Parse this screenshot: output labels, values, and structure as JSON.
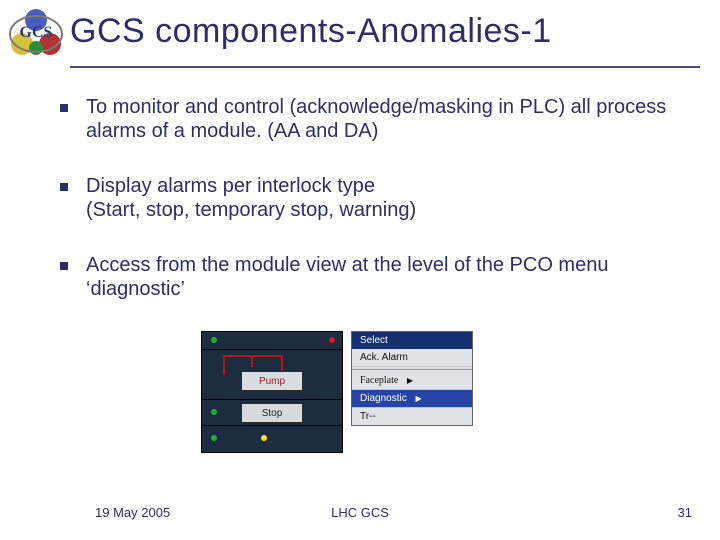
{
  "title": "GCS components-Anomalies-1",
  "logo_text": "GCS",
  "bullets": [
    "To monitor and control (acknowledge/masking in PLC) all process alarms of a module. (AA and DA)",
    "Display alarms per interlock type\n(Start, stop, temporary stop, warning)",
    "Access from the module view at the level of the PCO menu ‘diagnostic’"
  ],
  "mini": {
    "pump_label": "Pump",
    "stop_label": "Stop",
    "menu1": {
      "header": "Select",
      "items": [
        "Ack. Alarm"
      ],
      "faceplate_label": "Faceplate",
      "highlight": "Diagnostic",
      "trend": "Tr--"
    }
  },
  "footer": {
    "date": "19 May 2005",
    "center": "LHC GCS",
    "page": "31"
  },
  "colors": {
    "brand": "#2d2d6a",
    "menu_highlight": "#2544a5"
  }
}
